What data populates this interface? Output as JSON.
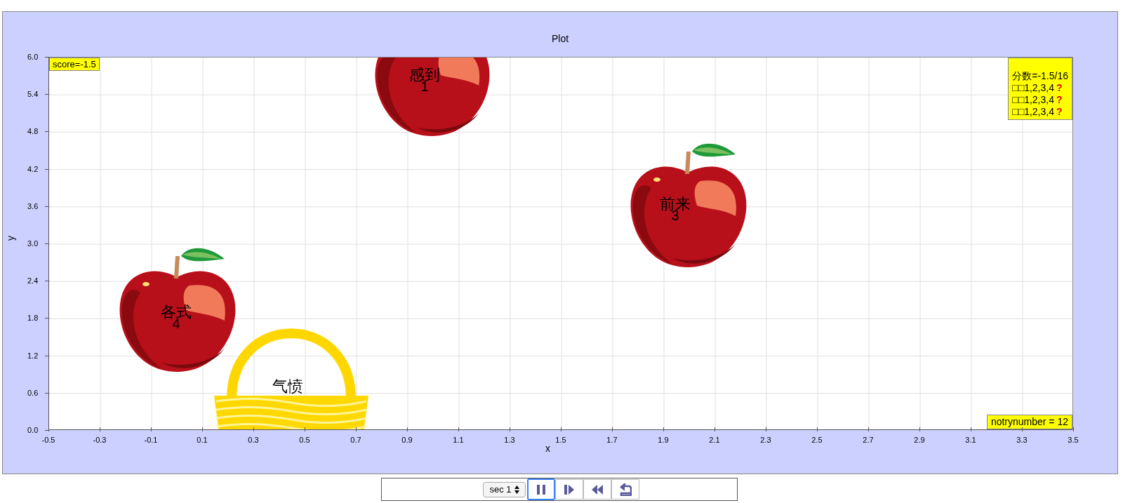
{
  "plot": {
    "title": "Plot",
    "xlabel": "x",
    "ylabel": "y",
    "x_ticks": [
      "-0.5",
      "-0.3",
      "-0.1",
      "0.1",
      "0.3",
      "0.5",
      "0.7",
      "0.9",
      "1.1",
      "1.3",
      "1.5",
      "1.7",
      "1.9",
      "2.1",
      "2.3",
      "2.5",
      "2.7",
      "2.9",
      "3.1",
      "3.3",
      "3.5"
    ],
    "y_ticks": [
      "6.0",
      "5.4",
      "4.8",
      "4.2",
      "3.6",
      "3.0",
      "2.4",
      "1.8",
      "1.2",
      "0.6",
      "0.0"
    ],
    "score_label": "score=-1.5",
    "summary": {
      "title": "分数=-1.5/16",
      "lines": [
        {
          "text": "□□1,2,3,4",
          "mark": "?"
        },
        {
          "text": "□□1,2,3,4",
          "mark": "?"
        },
        {
          "text": "□□1,2,3,4",
          "mark": "?"
        }
      ]
    },
    "tries_label": "notrynumber = 12",
    "items": [
      {
        "kind": "apple",
        "word": "感到",
        "number": "1"
      },
      {
        "kind": "apple",
        "word": "前来",
        "number": "3"
      },
      {
        "kind": "apple",
        "word": "各式",
        "number": "4"
      },
      {
        "kind": "basket",
        "word": "气愤"
      }
    ]
  },
  "controls": {
    "select": "sec 1",
    "buttons": [
      {
        "kind": "pause",
        "focused": true
      },
      {
        "kind": "step",
        "focused": false
      },
      {
        "kind": "rewind",
        "focused": false
      },
      {
        "kind": "reset",
        "focused": false
      }
    ]
  }
}
